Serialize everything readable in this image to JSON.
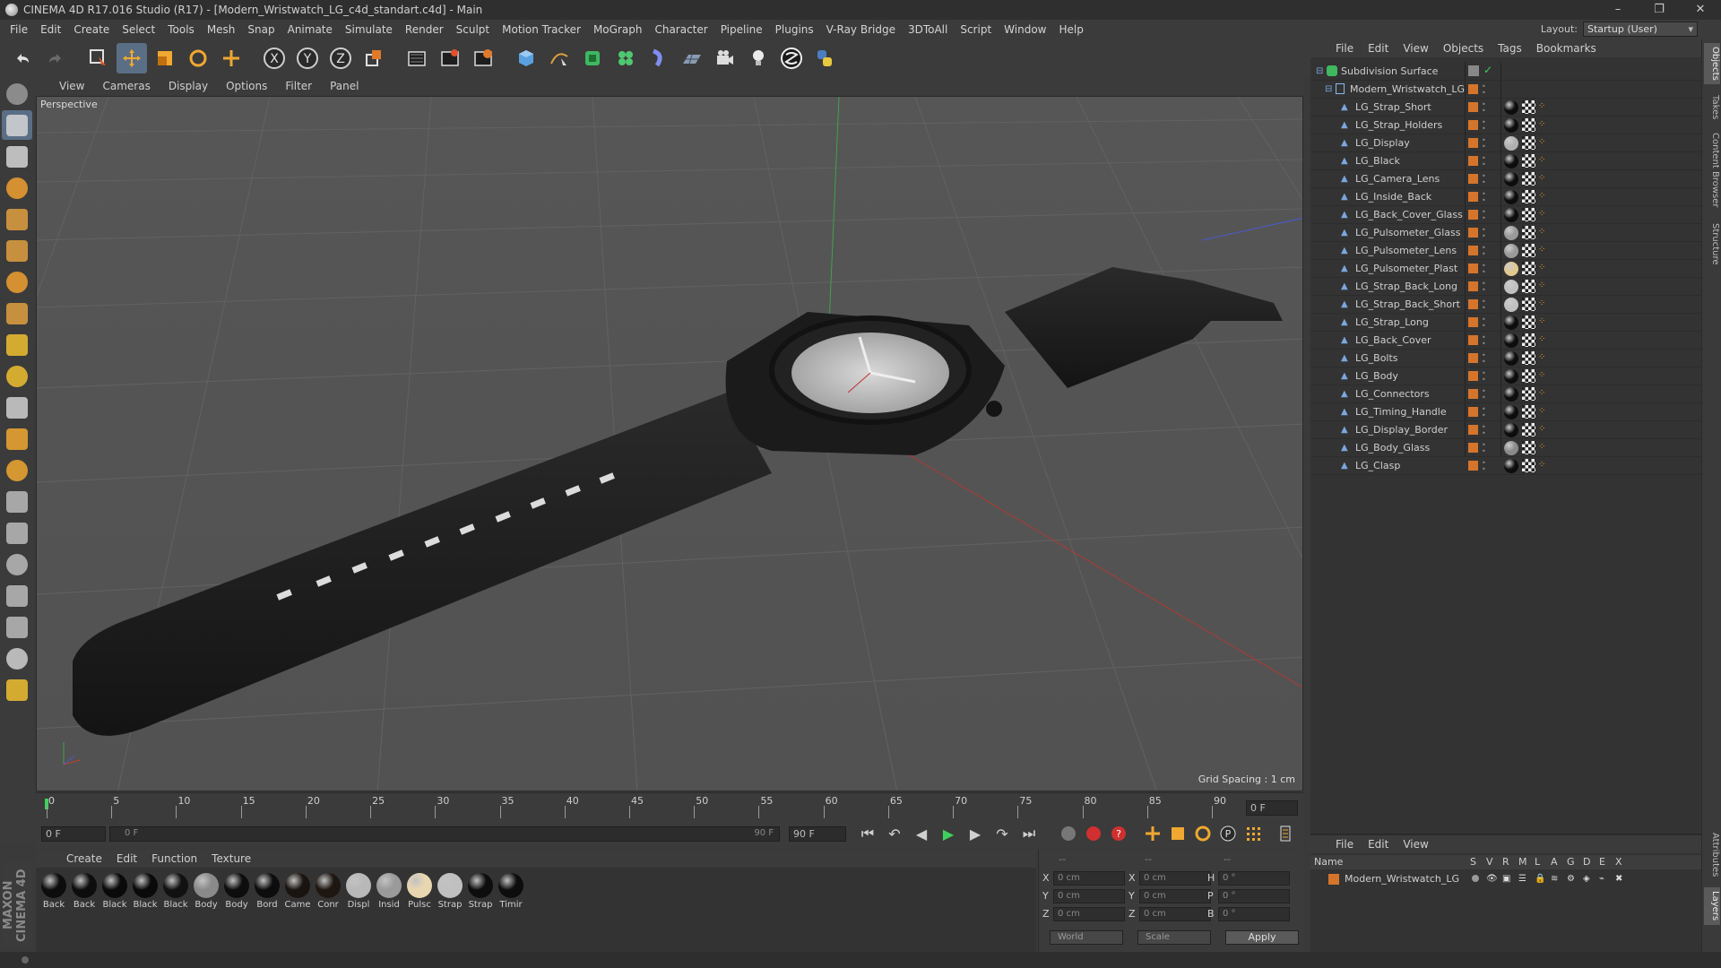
{
  "app": {
    "title": "CINEMA 4D R17.016 Studio (R17) - [Modern_Wristwatch_LG_c4d_standart.c4d] - Main",
    "window_controls": [
      "–",
      "❐",
      "✕"
    ]
  },
  "menubar": {
    "items": [
      "File",
      "Edit",
      "Create",
      "Select",
      "Tools",
      "Mesh",
      "Snap",
      "Animate",
      "Simulate",
      "Render",
      "Sculpt",
      "Motion Tracker",
      "MoGraph",
      "Character",
      "Pipeline",
      "Plugins",
      "V-Ray Bridge",
      "3DToAll",
      "Script",
      "Window",
      "Help"
    ],
    "layout_label": "Layout:",
    "layout_value": "Startup (User)"
  },
  "toolbar": {
    "icons": [
      "undo-icon",
      "redo-icon",
      "live-selection-icon",
      "move-icon",
      "scale-icon",
      "rotate-icon",
      "transform-icon",
      "x-axis-icon",
      "y-axis-icon",
      "z-axis-icon",
      "coordinate-system-icon",
      "render-view-icon",
      "render-picture-viewer-icon",
      "edit-render-settings-icon",
      "cube-icon",
      "pen-spline-icon",
      "subdivision-icon",
      "cloner-icon",
      "deformer-icon",
      "floor-icon",
      "camera-icon",
      "light-icon",
      "vray-icon",
      "python-icon"
    ],
    "axis_labels": [
      "X",
      "Y",
      "Z"
    ]
  },
  "left_tools": [
    "make-editable-icon",
    "model-mode-icon",
    "texture-mode-icon",
    "workplane-icon",
    "points-mode-icon",
    "edges-mode-icon",
    "polygons-mode-icon",
    "uv-mode-icon",
    "move-tool-icon",
    "soft-selection-icon",
    "magnet-icon",
    "axis-icon",
    "brush-icon",
    "knife-icon",
    "bridge-icon",
    "extrude-icon",
    "weld-icon",
    "snap-icon",
    "grid-lock-icon",
    "python-icon"
  ],
  "viewport": {
    "menu": [
      "View",
      "Cameras",
      "Display",
      "Options",
      "Filter",
      "Panel"
    ],
    "label": "Perspective",
    "grid_spacing": "Grid Spacing : 1 cm"
  },
  "timeline": {
    "ticks": [
      "0",
      "5",
      "10",
      "15",
      "20",
      "25",
      "30",
      "35",
      "40",
      "45",
      "50",
      "55",
      "60",
      "65",
      "70",
      "75",
      "80",
      "85",
      "90"
    ],
    "current_frame": "0 F",
    "start_frame": "0 F",
    "range_start": "0 F",
    "range_end": "90 F",
    "end_frame": "90 F"
  },
  "materials": {
    "menu": [
      "Create",
      "Edit",
      "Function",
      "Texture"
    ],
    "items": [
      {
        "label": "Back",
        "color": "#0d0d0d"
      },
      {
        "label": "Back",
        "color": "#0d0d0d"
      },
      {
        "label": "Black",
        "color": "#0a0a0a"
      },
      {
        "label": "Black",
        "color": "#0a0a0a"
      },
      {
        "label": "Black",
        "color": "#111111"
      },
      {
        "label": "Body",
        "color": "#8a8a8a"
      },
      {
        "label": "Body",
        "color": "#0d0d0d"
      },
      {
        "label": "Bord",
        "color": "#0d0d0d"
      },
      {
        "label": "Came",
        "color": "#1a1410"
      },
      {
        "label": "Conr",
        "color": "#1e1610"
      },
      {
        "label": "Displ",
        "color": "#b8b8b8"
      },
      {
        "label": "Insid",
        "color": "#9a9a9a"
      },
      {
        "label": "Pulsc",
        "color": "#e8d6b0"
      },
      {
        "label": "Strap",
        "color": "#c0c0c0"
      },
      {
        "label": "Strap",
        "color": "#0d0d0d"
      },
      {
        "label": "Timir",
        "color": "#0d0d0d"
      }
    ]
  },
  "coordinates": {
    "header": [
      "--",
      "--",
      "--"
    ],
    "rows": [
      {
        "a": "X",
        "av": "0 cm",
        "b": "X",
        "bv": "0 cm",
        "c": "H",
        "cv": "0 °"
      },
      {
        "a": "Y",
        "av": "0 cm",
        "b": "Y",
        "bv": "0 cm",
        "c": "P",
        "cv": "0 °"
      },
      {
        "a": "Z",
        "av": "0 cm",
        "b": "Z",
        "bv": "0 cm",
        "c": "B",
        "cv": "0 °"
      }
    ],
    "mode_world": "World",
    "mode_scale": "Scale",
    "apply": "Apply"
  },
  "object_manager": {
    "menu": [
      "File",
      "Edit",
      "View",
      "Objects",
      "Tags",
      "Bookmarks"
    ],
    "root": "Subdivision Surface",
    "group": "Modern_Wristwatch_LG",
    "objects": [
      {
        "name": "LG_Strap_Short",
        "tag": "#0d0d0d"
      },
      {
        "name": "LG_Strap_Holders",
        "tag": "#0d0d0d"
      },
      {
        "name": "LG_Display",
        "tag": "#b0b0b0"
      },
      {
        "name": "LG_Black",
        "tag": "#0d0d0d"
      },
      {
        "name": "LG_Camera_Lens",
        "tag": "#0d0d0d"
      },
      {
        "name": "LG_Inside_Back",
        "tag": "#0d0d0d"
      },
      {
        "name": "LG_Back_Cover_Glass",
        "tag": "#0d0d0d"
      },
      {
        "name": "LG_Pulsometer_Glass",
        "tag": "#9a9a9a"
      },
      {
        "name": "LG_Pulsometer_Lens",
        "tag": "#9a9a9a"
      },
      {
        "name": "LG_Pulsometer_Plast",
        "tag": "#e0c890"
      },
      {
        "name": "LG_Strap_Back_Long",
        "tag": "#c0c0c0"
      },
      {
        "name": "LG_Strap_Back_Short",
        "tag": "#c0c0c0"
      },
      {
        "name": "LG_Strap_Long",
        "tag": "#0d0d0d"
      },
      {
        "name": "LG_Back_Cover",
        "tag": "#0d0d0d"
      },
      {
        "name": "LG_Bolts",
        "tag": "#0d0d0d"
      },
      {
        "name": "LG_Body",
        "tag": "#0d0d0d"
      },
      {
        "name": "LG_Connectors",
        "tag": "#0d0d0d"
      },
      {
        "name": "LG_Timing_Handle",
        "tag": "#0d0d0d"
      },
      {
        "name": "LG_Display_Border",
        "tag": "#0d0d0d"
      },
      {
        "name": "LG_Body_Glass",
        "tag": "#8a8a8a"
      },
      {
        "name": "LG_Clasp",
        "tag": "#0d0d0d"
      }
    ]
  },
  "layers": {
    "menu": [
      "File",
      "Edit",
      "View"
    ],
    "columns": [
      "Name",
      "S",
      "V",
      "R",
      "M",
      "L",
      "A",
      "G",
      "D",
      "E",
      "X"
    ],
    "row_name": "Modern_Wristwatch_LG"
  },
  "right_tabs": [
    "Objects",
    "Takes",
    "Content Browser",
    "Structure",
    "Attributes",
    "Layers"
  ],
  "brand": "MAXON CINEMA 4D",
  "colors": {
    "accent": "#d5752c",
    "ui_bg": "#3b3b3b",
    "viewport": "#555555"
  }
}
